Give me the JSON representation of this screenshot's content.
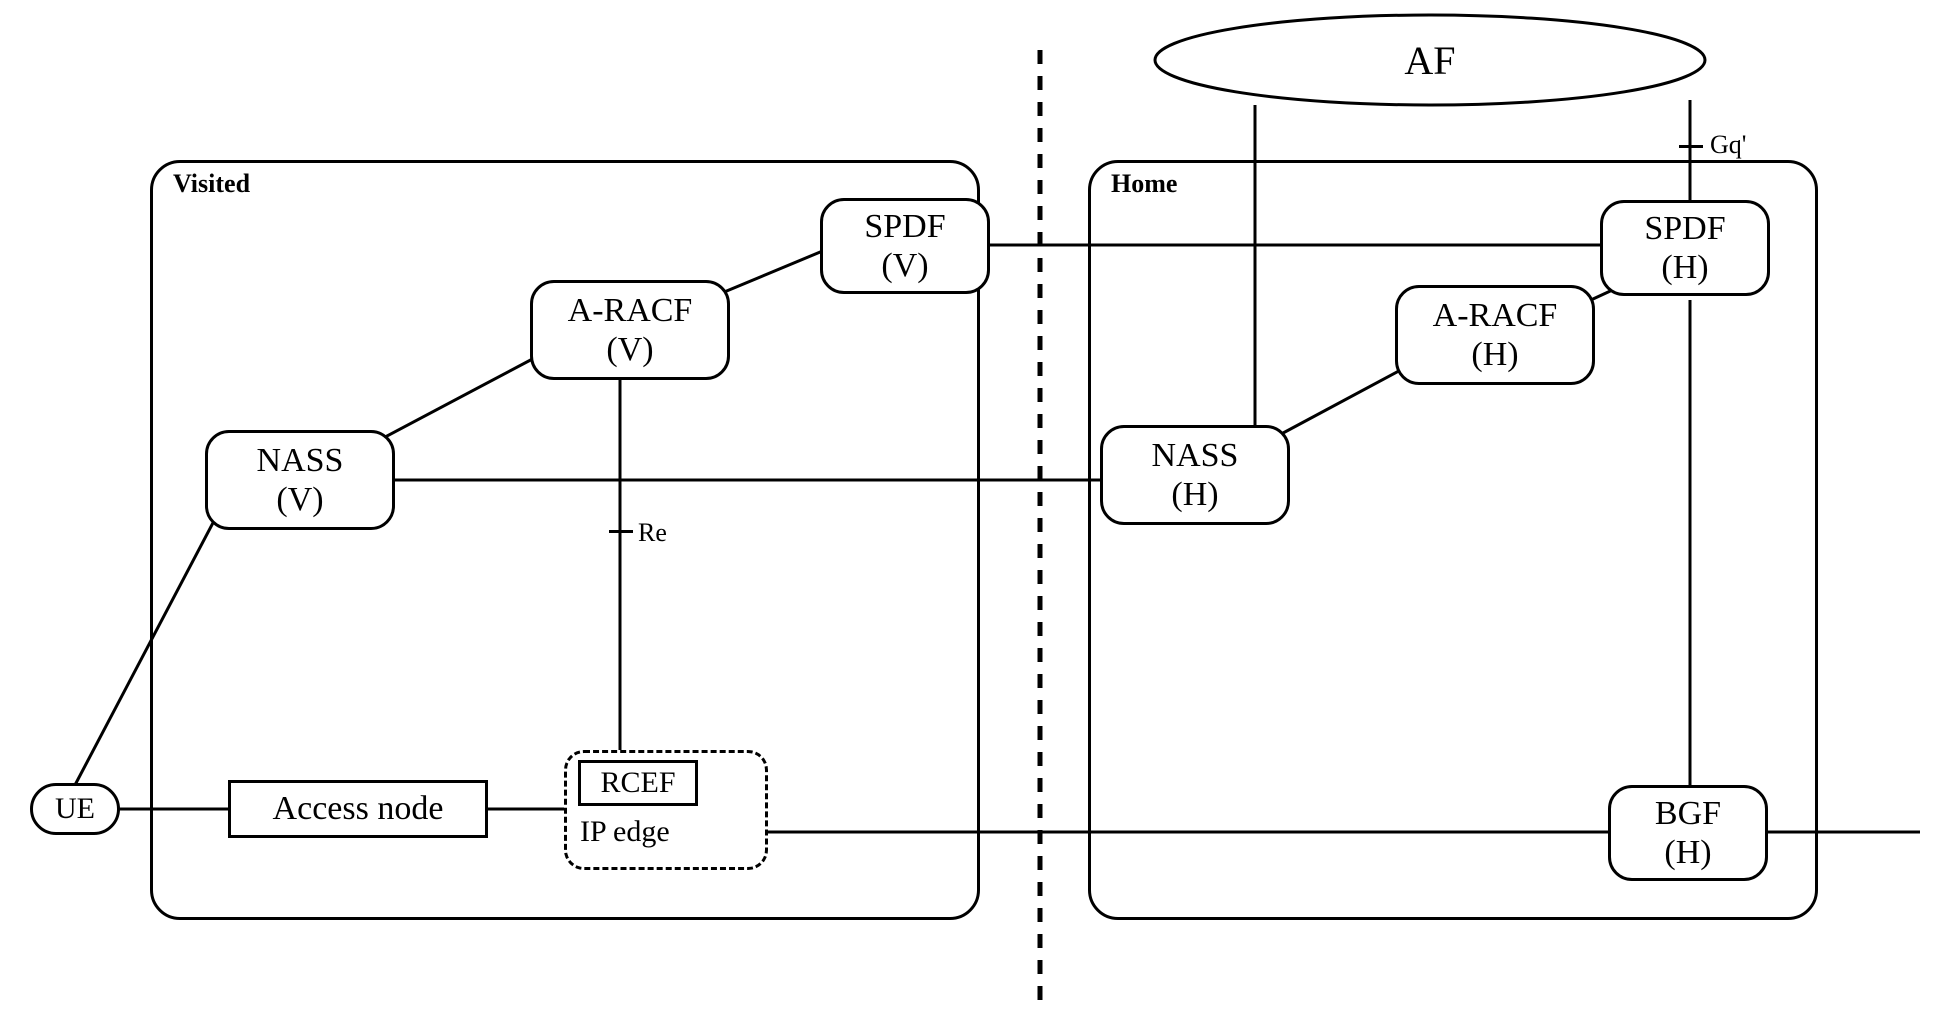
{
  "groups": {
    "visited": {
      "label": "Visited"
    },
    "home": {
      "label": "Home"
    }
  },
  "nodes": {
    "af": {
      "label": "AF"
    },
    "ue": {
      "label": "UE"
    },
    "access": {
      "label": "Access node"
    },
    "rcef": {
      "label": "RCEF"
    },
    "ipedge": {
      "label": "IP edge"
    },
    "nass_v": {
      "label": "NASS\n(V)"
    },
    "aracf_v": {
      "label": "A-RACF\n(V)"
    },
    "spdf_v": {
      "label": "SPDF\n(V)"
    },
    "nass_h": {
      "label": "NASS\n(H)"
    },
    "aracf_h": {
      "label": "A-RACF\n(H)"
    },
    "spdf_h": {
      "label": "SPDF\n(H)"
    },
    "bgf_h": {
      "label": "BGF\n(H)"
    }
  },
  "interfaces": {
    "re": {
      "label": "Re"
    },
    "gq": {
      "label": "Gq'"
    }
  }
}
